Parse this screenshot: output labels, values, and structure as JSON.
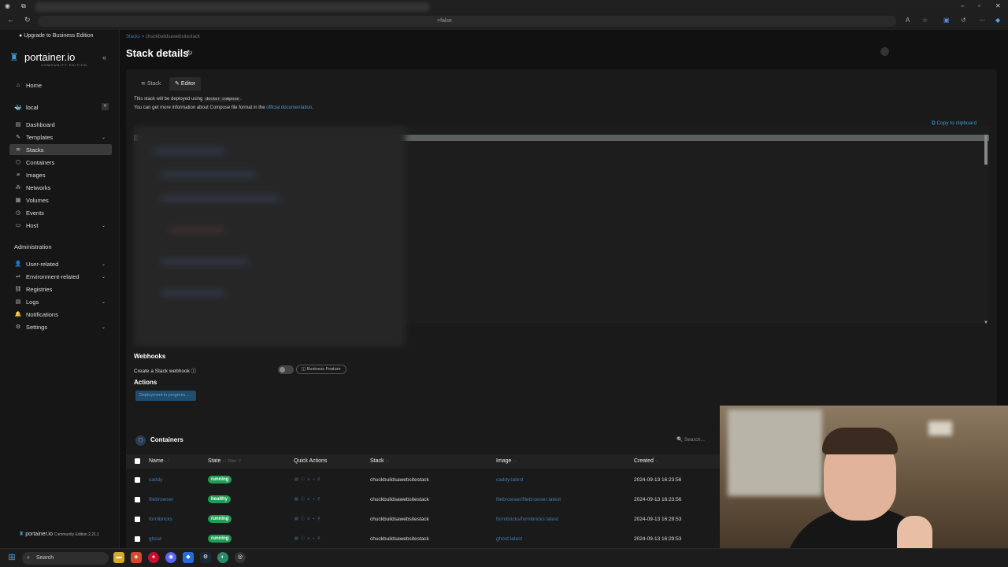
{
  "browser": {
    "address_suffix": "=false"
  },
  "sidebar": {
    "upgrade": "Upgrade to Business Edition",
    "logo": "portainer.io",
    "logo_sub": "COMMUNITY EDITION",
    "home": "Home",
    "environment": "local",
    "items": [
      {
        "label": "Dashboard"
      },
      {
        "label": "Templates"
      },
      {
        "label": "Stacks"
      },
      {
        "label": "Containers"
      },
      {
        "label": "Images"
      },
      {
        "label": "Networks"
      },
      {
        "label": "Volumes"
      },
      {
        "label": "Events"
      },
      {
        "label": "Host"
      }
    ],
    "admin_heading": "Administration",
    "admin_items": [
      {
        "label": "User-related"
      },
      {
        "label": "Environment-related"
      },
      {
        "label": "Registries"
      },
      {
        "label": "Logs"
      },
      {
        "label": "Notifications"
      },
      {
        "label": "Settings"
      }
    ],
    "footer_brand": "portainer.io",
    "footer_version": "Community Edition 2.21.1"
  },
  "main": {
    "breadcrumb_root": "Stacks",
    "breadcrumb_sep": ">",
    "breadcrumb_current": "chuckbuildsawebsitestack",
    "title": "Stack details",
    "tabs": [
      {
        "label": "Stack"
      },
      {
        "label": "Editor"
      }
    ],
    "info_line1_a": "This stack will be deployed using",
    "info_line1_code": "docker compose",
    "info_line1_b": ".",
    "info_line2_a": "You can get more information about Compose file format in the",
    "info_line2_link": "official documentation",
    "info_line2_b": ".",
    "copy_label": "Copy to clipboard",
    "webhooks_heading": "Webhooks",
    "webhook_label": "Create a Stack webhook",
    "business_feature": "Business Feature",
    "actions_heading": "Actions",
    "deploy_button": "Deployment in progress..."
  },
  "containers": {
    "title": "Containers",
    "search_placeholder": "Search...",
    "columns": {
      "name": "Name",
      "state": "State",
      "filter": "Filter",
      "quick_actions": "Quick Actions",
      "stack": "Stack",
      "image": "Image",
      "created": "Created"
    },
    "rows": [
      {
        "name": "caddy",
        "state": "running",
        "stack": "chuckbuildsawebsitestack",
        "image": "caddy:latest",
        "created": "2024-09-13 16:23:56"
      },
      {
        "name": "filebrowser",
        "state": "healthy",
        "stack": "chuckbuildsawebsitestack",
        "image": "filebrowser/filebrowser:latest",
        "created": "2024-09-13 16:23:56"
      },
      {
        "name": "formbricks",
        "state": "running",
        "stack": "chuckbuildsawebsitestack",
        "image": "formbricks/formbricks:latest",
        "created": "2024-09-13 16:29:53"
      },
      {
        "name": "ghost",
        "state": "running",
        "stack": "chuckbuildsawebsitestack",
        "image": "ghost:latest",
        "created": "2024-09-13 16:29:53"
      }
    ]
  },
  "taskbar": {
    "search": "Search"
  },
  "colors": {
    "accent": "#3e7bb8",
    "badge_green": "#1f9d55"
  }
}
